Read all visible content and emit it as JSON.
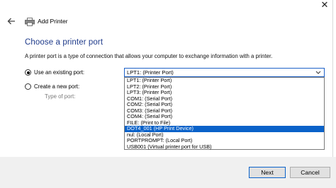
{
  "window": {
    "title": "Add Printer",
    "close_icon": "close-icon",
    "back_icon": "back-arrow-icon",
    "printer_icon": "printer-icon"
  },
  "page": {
    "heading": "Choose a printer port",
    "description": "A printer port is a type of connection that allows your computer to exchange information with a printer."
  },
  "options": {
    "existing_label": "Use an existing port:",
    "existing_checked": true,
    "new_label": "Create a new port:",
    "new_checked": false,
    "type_label": "Type of port:"
  },
  "port_select": {
    "value": "LPT1: (Printer Port)",
    "options": [
      "LPT1: (Printer Port)",
      "LPT2: (Printer Port)",
      "LPT3: (Printer Port)",
      "COM1: (Serial Port)",
      "COM2: (Serial Port)",
      "COM3: (Serial Port)",
      "COM4: (Serial Port)",
      "FILE: (Print to File)",
      "DOT4_001 (HP Print Device)",
      "nul: (Local Port)",
      "PORTPROMPT: (Local Port)",
      "USB001 (Virtual printer port for USB)"
    ],
    "highlighted": "DOT4_001 (HP Print Device)"
  },
  "footer": {
    "next_label": "Next",
    "cancel_label": "Cancel"
  },
  "colors": {
    "heading": "#1e3a8a",
    "accent": "#0a62c9",
    "footer_bg": "#f0f0f0"
  }
}
